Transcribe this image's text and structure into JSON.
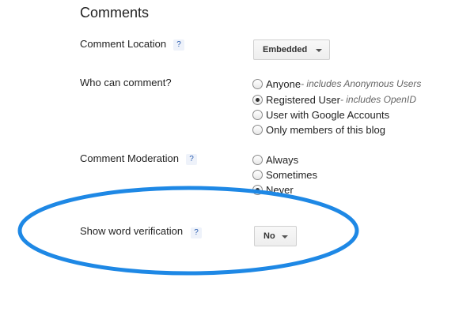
{
  "section": {
    "title": "Comments"
  },
  "comment_location": {
    "label": "Comment Location",
    "help": "?",
    "dropdown_value": "Embedded"
  },
  "who_can_comment": {
    "label": "Who can comment?",
    "options": [
      {
        "label": "Anyone",
        "hint": " - includes Anonymous Users",
        "selected": false
      },
      {
        "label": "Registered User",
        "hint": " - includes OpenID",
        "selected": true
      },
      {
        "label": "User with Google Accounts",
        "hint": "",
        "selected": false
      },
      {
        "label": "Only members of this blog",
        "hint": "",
        "selected": false
      }
    ]
  },
  "comment_moderation": {
    "label": "Comment Moderation",
    "help": "?",
    "options": [
      {
        "label": "Always",
        "selected": false
      },
      {
        "label": "Sometimes",
        "selected": false
      },
      {
        "label": "Never",
        "selected": true
      }
    ]
  },
  "word_verification": {
    "label": "Show word verification",
    "help": "?",
    "dropdown_value": "No"
  },
  "highlight": {
    "color": "#1e88e5"
  }
}
